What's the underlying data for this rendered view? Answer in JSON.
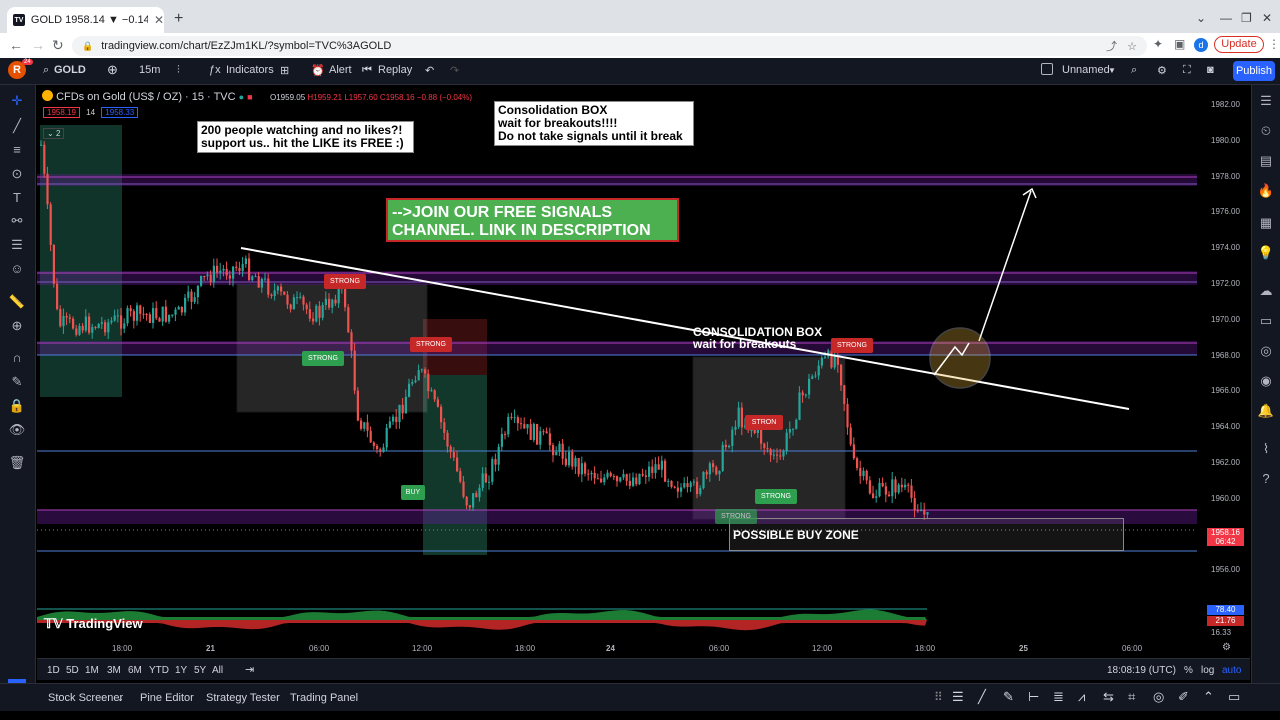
{
  "browser": {
    "tab_title": "GOLD 1958.14 ▼ −0.14% U",
    "url": "tradingview.com/chart/EzZJm1KL/?symbol=TVC%3AGOLD",
    "update_label": "Update",
    "profile_initial": "d"
  },
  "toolbar": {
    "avatar_initial": "R",
    "avatar_badge": "24",
    "symbol": "GOLD",
    "interval": "15m",
    "indicators": "Indicators",
    "alert": "Alert",
    "replay": "Replay",
    "layout_name": "Unnamed",
    "publish": "Publish"
  },
  "legend": {
    "instrument": "CFDs on Gold (US$ / OZ) · 15 · TVC",
    "open": "O1959.05",
    "high": "H1959.21",
    "low": "L1957.60",
    "close": "C1958.16",
    "change": "−0.88 (−0.04%)",
    "bid": "1958.19",
    "spread": "14",
    "ask": "1958.33",
    "collapse_count": "2"
  },
  "annotations": {
    "likes_box": [
      "200 people watching and no likes?!",
      "support us.. hit the LIKE its FREE :)"
    ],
    "consolidation_note": [
      "Consolidation BOX",
      "wait for breakouts!!!!",
      "Do not take signals until it break"
    ],
    "join_banner": [
      "-->JOIN OUR FREE SIGNALS",
      "CHANNEL. LINK IN DESCRIPTION"
    ],
    "consol_box_label": [
      "CONSOLIDATION BOX",
      "wait for breakouts"
    ],
    "buy_zone": "POSSIBLE BUY ZONE",
    "strong": "STRONG",
    "strong_cut": "STRON",
    "buy": "BUY"
  },
  "price_axis": {
    "labels": [
      "1982.00",
      "1980.00",
      "1978.00",
      "1976.00",
      "1974.00",
      "1972.00",
      "1970.00",
      "1968.00",
      "1966.00",
      "1964.00",
      "1962.00",
      "1960.00",
      "1958.00",
      "1956.00"
    ],
    "current_price": "1958.16",
    "countdown": "06:42",
    "osc_values": [
      "78.40",
      "21.76",
      "16.33"
    ]
  },
  "time_axis": {
    "labels": [
      "18:00",
      "21",
      "06:00",
      "12:00",
      "18:00",
      "24",
      "06:00",
      "12:00",
      "18:00",
      "25",
      "06:00"
    ],
    "clock": "18:08:19 (UTC)",
    "pct": "%",
    "log": "log",
    "auto": "auto"
  },
  "ranges": [
    "1D",
    "5D",
    "1M",
    "3M",
    "6M",
    "YTD",
    "1Y",
    "5Y",
    "All"
  ],
  "watermark": "TradingView",
  "bottom_panels": [
    "Stock Screener",
    "Pine Editor",
    "Strategy Tester",
    "Trading Panel"
  ],
  "colors": {
    "up": "#26a69a",
    "down": "#ef5350",
    "accent": "#2962ff",
    "zone_purple": "#9c27b0"
  }
}
